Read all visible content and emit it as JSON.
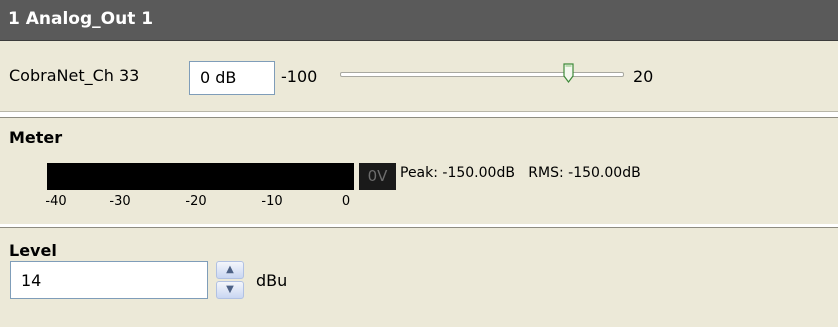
{
  "window": {
    "title": "1 Analog_Out 1"
  },
  "gain": {
    "channel_label": "CobraNet_Ch 33",
    "value": "0 dB",
    "min_label": "-100",
    "max_label": "20",
    "slider_value_db": 0
  },
  "meter": {
    "heading": "Meter",
    "overload_label": "0V",
    "readout": "Peak: -150.00dB   RMS: -150.00dB",
    "ticks": [
      "-40",
      "-30",
      "-20",
      "-10",
      "0"
    ]
  },
  "level": {
    "heading": "Level",
    "value": "14",
    "unit": "dBu"
  },
  "colors": {
    "title_bar": "#5a5a5a",
    "panel": "#ece9d8",
    "meter_background": "#000000"
  }
}
